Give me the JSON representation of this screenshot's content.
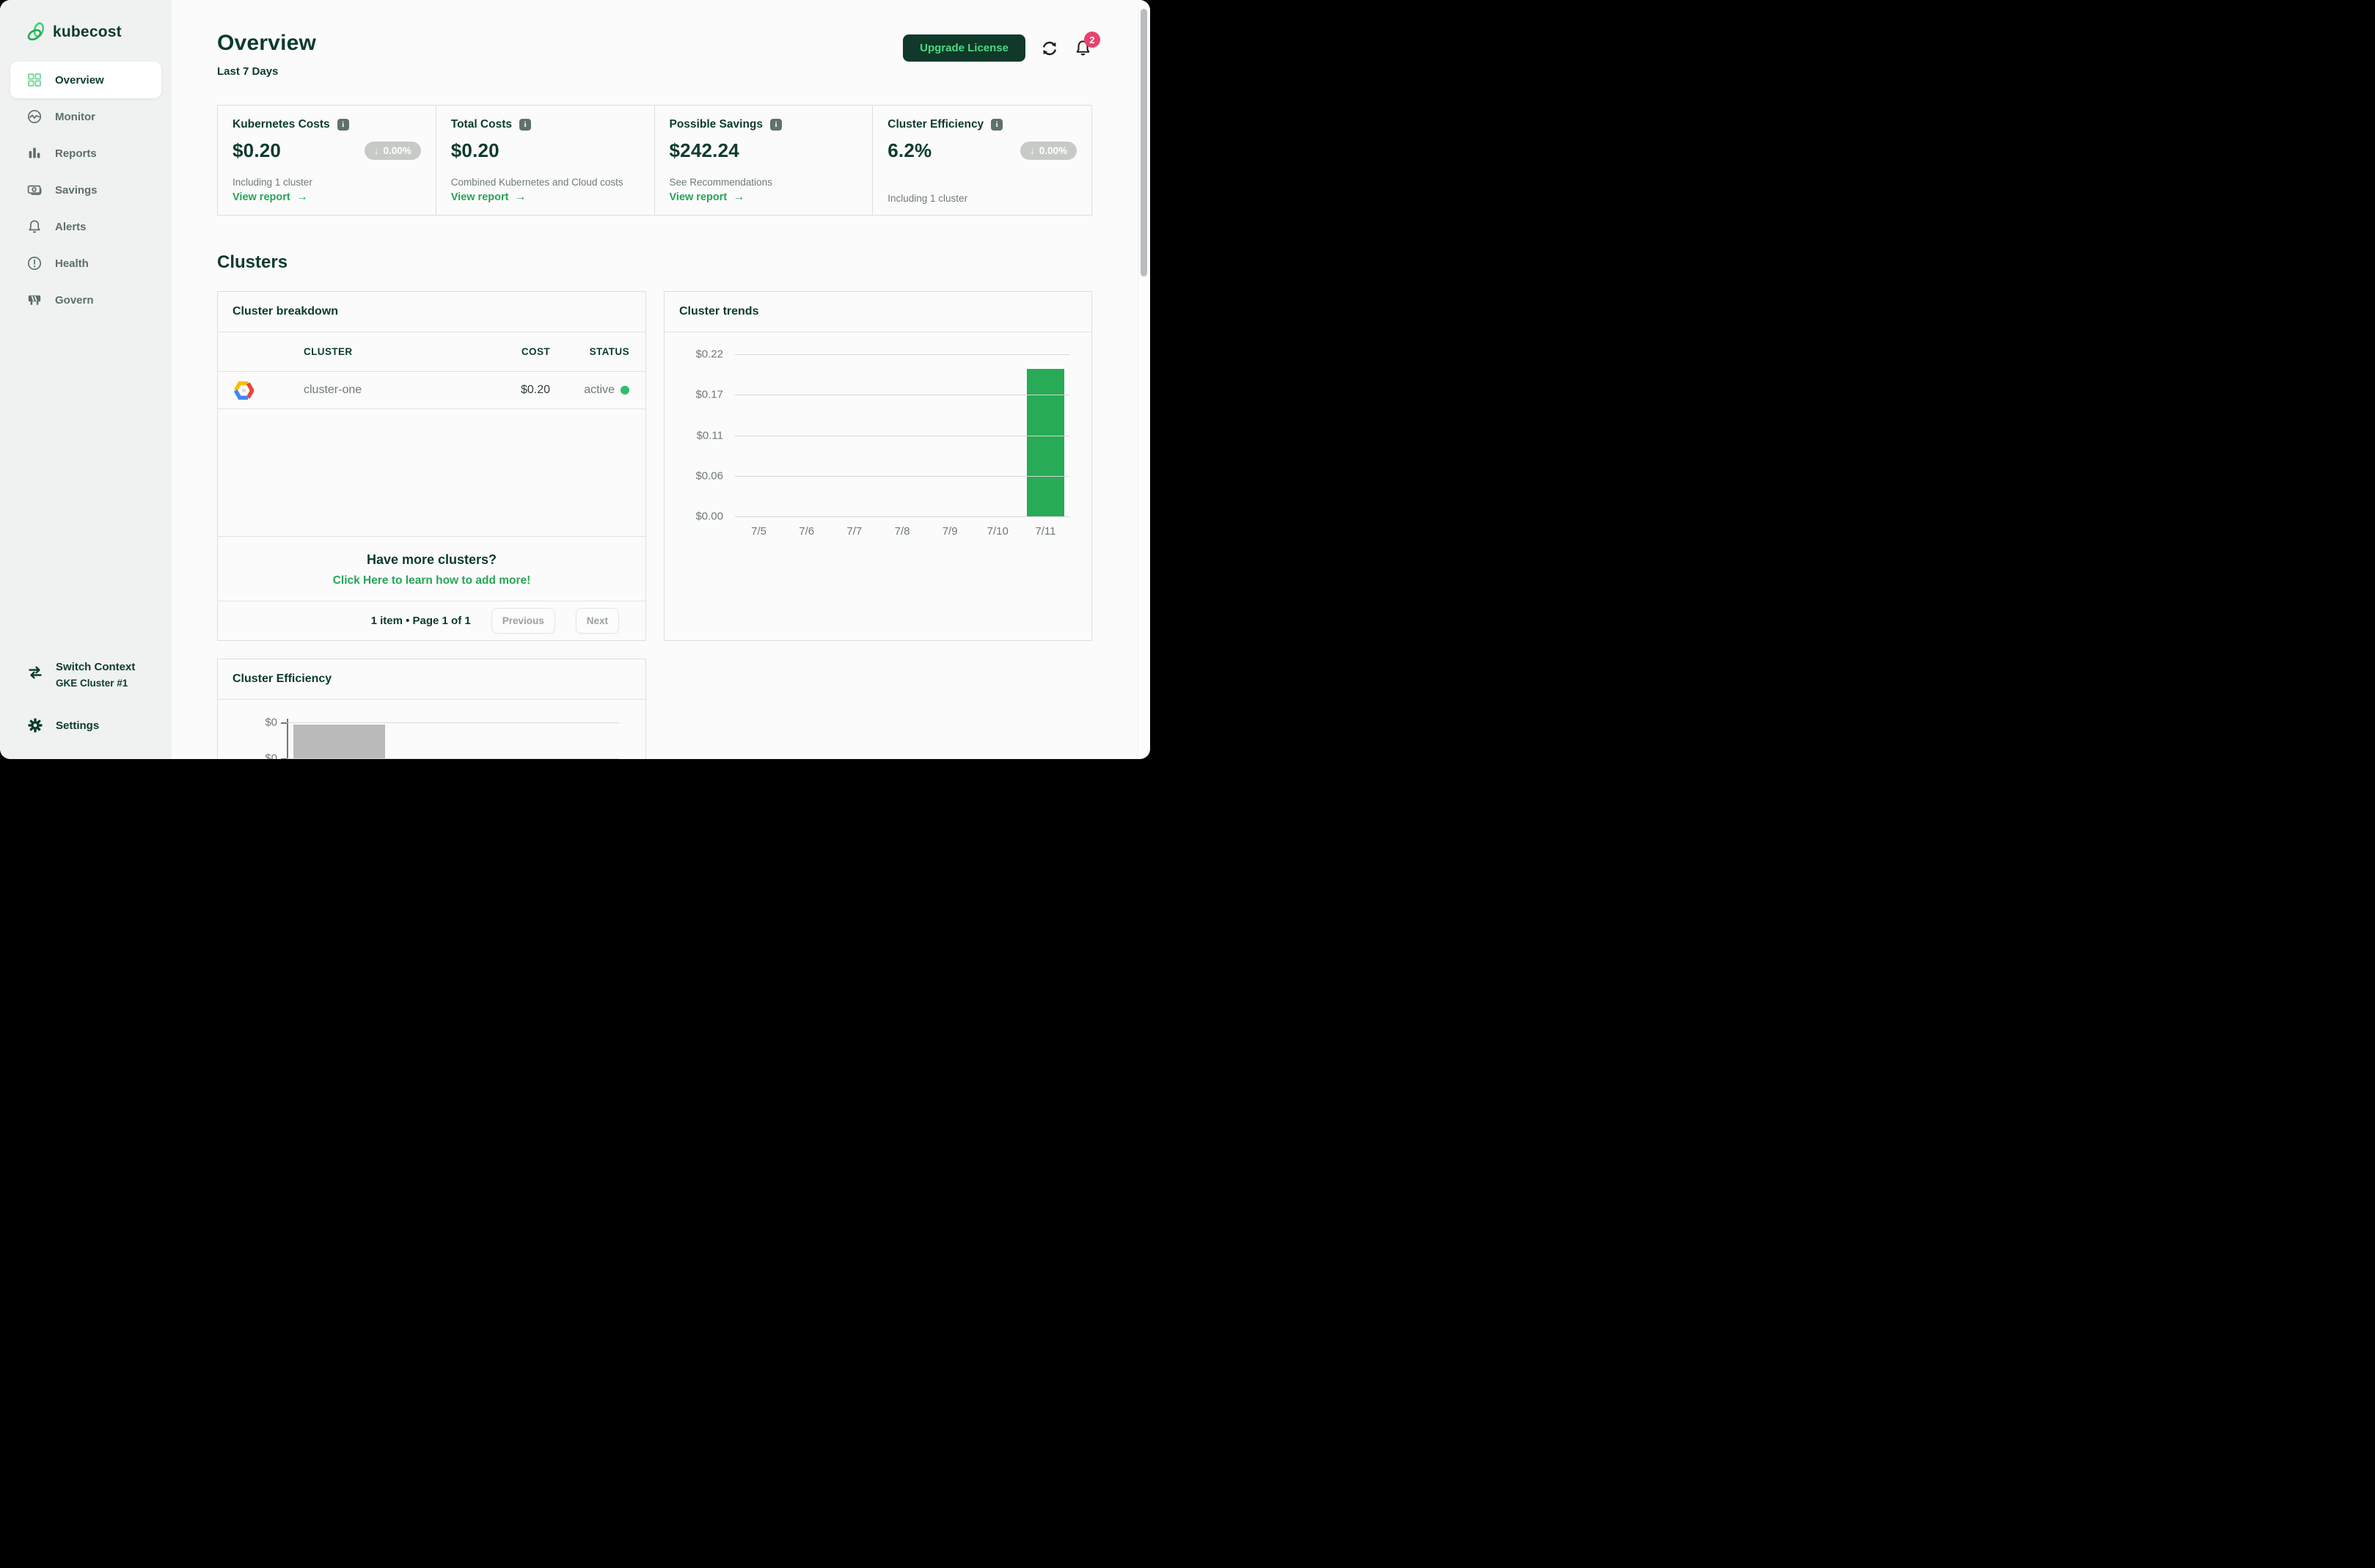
{
  "brand": {
    "name": "kubecost"
  },
  "sidebar": {
    "items": [
      {
        "label": "Overview"
      },
      {
        "label": "Monitor"
      },
      {
        "label": "Reports"
      },
      {
        "label": "Savings"
      },
      {
        "label": "Alerts"
      },
      {
        "label": "Health"
      },
      {
        "label": "Govern"
      }
    ],
    "switch_context": {
      "title": "Switch Context",
      "subtitle": "GKE Cluster #1"
    },
    "settings_label": "Settings"
  },
  "header": {
    "title": "Overview",
    "subtitle": "Last 7 Days",
    "upgrade_label": "Upgrade License",
    "notification_count": "2"
  },
  "stats": {
    "cards": [
      {
        "title": "Kubernetes Costs",
        "value": "$0.20",
        "badge": "0.00%",
        "subtitle": "Including 1 cluster",
        "link": "View report"
      },
      {
        "title": "Total Costs",
        "value": "$0.20",
        "subtitle": "Combined Kubernetes and Cloud costs",
        "link": "View report"
      },
      {
        "title": "Possible Savings",
        "value": "$242.24",
        "subtitle": "See Recommendations",
        "link": "View report"
      },
      {
        "title": "Cluster Efficiency",
        "value": "6.2%",
        "badge": "0.00%",
        "subtitle": "Including 1 cluster"
      }
    ]
  },
  "clusters": {
    "heading": "Clusters",
    "breakdown": {
      "title": "Cluster breakdown",
      "columns": [
        "CLUSTER",
        "COST",
        "STATUS"
      ],
      "rows": [
        {
          "cluster": "cluster-one",
          "cost": "$0.20",
          "status": "active"
        }
      ],
      "empty_prompt": {
        "title": "Have more clusters?",
        "link": "Click Here to learn how to add more!"
      },
      "pagination": {
        "summary": "1 item • Page 1 of 1",
        "previous": "Previous",
        "next": "Next"
      }
    },
    "trends": {
      "title": "Cluster trends",
      "chart_data": {
        "type": "bar",
        "categories": [
          "7/5",
          "7/6",
          "7/7",
          "7/8",
          "7/9",
          "7/10",
          "7/11"
        ],
        "values": [
          0,
          0,
          0,
          0,
          0,
          0,
          0.2
        ],
        "ytick_labels": [
          "$0.22",
          "$0.17",
          "$0.11",
          "$0.06",
          "$0.00"
        ],
        "ylim": [
          0,
          0.22
        ],
        "grid": "horizontal",
        "legend": "none",
        "bar_color": "#27ab57"
      }
    }
  },
  "efficiency": {
    "title": "Cluster Efficiency",
    "chart_data": {
      "type": "bar",
      "ytick_labels": [
        "$0",
        "$0"
      ],
      "bar_color": "#b9bab9"
    }
  },
  "colors": {
    "brand_dark_green": "#0c3b2d",
    "accent_green": "#27a457",
    "bar_green": "#27ab57",
    "status_green": "#2fbd6a",
    "badge_gray": "#c7cbc7",
    "notification_pink": "#e8426d",
    "upgrade_button_bg": "#10392a",
    "upgrade_button_text": "#4bd980",
    "sidebar_bg": "#f0f2f1",
    "page_bg": "#fcfbfc"
  }
}
